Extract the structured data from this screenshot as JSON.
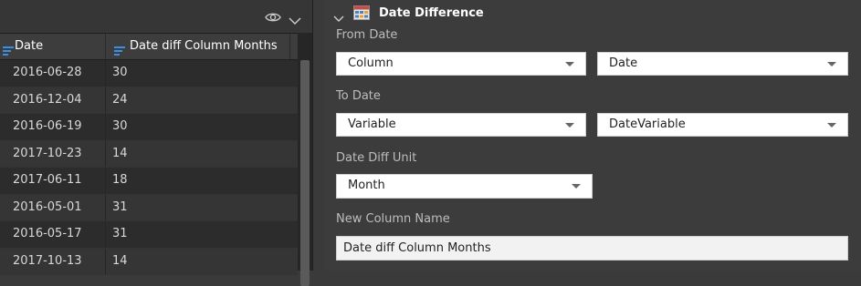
{
  "grid": {
    "columns": [
      "Date",
      "Date diff Column Months"
    ],
    "rows": [
      [
        "2016-06-28",
        "30"
      ],
      [
        "2016-12-04",
        "24"
      ],
      [
        "2016-06-19",
        "30"
      ],
      [
        "2017-10-23",
        "14"
      ],
      [
        "2017-06-11",
        "18"
      ],
      [
        "2016-05-01",
        "31"
      ],
      [
        "2016-05-17",
        "31"
      ],
      [
        "2017-10-13",
        "14"
      ]
    ]
  },
  "icons": {
    "visibility": "eye-icon",
    "expand": "chevron-down-icon",
    "sort": "sort-icon",
    "panel": "table-icon",
    "collapse": "chevron-down-icon"
  },
  "panel": {
    "title": "Date Difference",
    "from_date": {
      "label": "From Date",
      "type_value": "Column",
      "source_value": "Date"
    },
    "to_date": {
      "label": "To Date",
      "type_value": "Variable",
      "source_value": "DateVariable"
    },
    "unit": {
      "label": "Date Diff Unit",
      "value": "Month"
    },
    "new_column": {
      "label": "New Column Name",
      "value": "Date diff Column Months"
    }
  },
  "colors": {
    "accent_blue": "#3a8ee6",
    "panel_bg": "#3c3c3c",
    "grid_bg": "#2f2f2f"
  }
}
